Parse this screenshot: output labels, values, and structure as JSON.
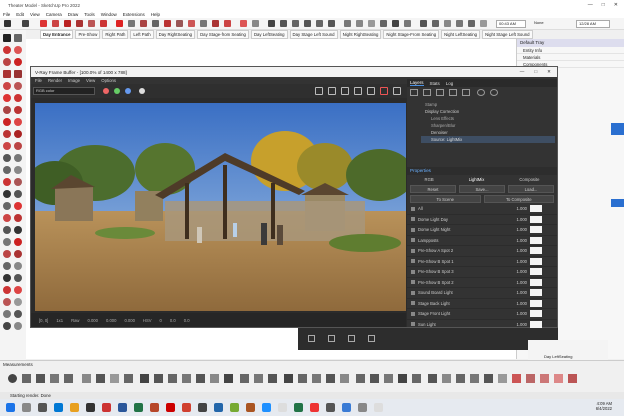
{
  "window": {
    "title": "Theater Model - SketchUp Pro 2022"
  },
  "menubar": {
    "items": [
      "File",
      "Edit",
      "View",
      "Camera",
      "Draw",
      "Tools",
      "Window",
      "Extensions",
      "Help"
    ]
  },
  "toolbar": {
    "time": "00:43 AM",
    "shadow": "None",
    "date": "12/28 AM"
  },
  "scene_tabs": [
    "Day Entrance",
    "Pre-Show",
    "Right Path",
    "Left Path",
    "Day RightSeating",
    "Day Stage-from Seating",
    "Day LeftSeating",
    "Day Stage Left Sound",
    "Night RightSeating",
    "Night Stage-From Seating",
    "Night LeftSeating",
    "Night Stage Left Sound"
  ],
  "tray": {
    "title": "Default Tray",
    "items": [
      "Entity Info",
      "Materials",
      "Components"
    ]
  },
  "vfb": {
    "title": "V-Ray Frame Buffer - [100.0% of 1400 x 788]",
    "menu": [
      "File",
      "Render",
      "Image",
      "View",
      "Options"
    ],
    "channel": "RGB color",
    "status": [
      "[0, 0]",
      "1x1",
      "Raw",
      "0.000",
      "0.000",
      "0.000",
      "HSV",
      "0",
      "0.0",
      "0.0"
    ],
    "panel": {
      "tabs": [
        "Layers",
        "Stats",
        "Log"
      ],
      "layers": [
        "Stamp",
        "Display Correction",
        "Lens Effects",
        "Sharpen/Blur",
        "Denoiser",
        "Source: LightMix"
      ],
      "properties_title": "Properties",
      "mode_options": [
        "RGB",
        "LightMix",
        "Composite"
      ],
      "buttons": [
        "Reset",
        "Save...",
        "Load..."
      ],
      "scene_buttons": [
        "To Scene",
        "To Composite"
      ],
      "lights": [
        {
          "name": "All",
          "value": "1.000"
        },
        {
          "name": "Dome Light Day",
          "value": "1.000"
        },
        {
          "name": "Dome Light Night",
          "value": "1.000"
        },
        {
          "name": "Lampposts",
          "value": "1.000"
        },
        {
          "name": "Pre-Show A Spot 2",
          "value": "1.000"
        },
        {
          "name": "Pre-Show B Spot 1",
          "value": "1.000"
        },
        {
          "name": "Pre-Show B Spot 3",
          "value": "1.000"
        },
        {
          "name": "Pre-Show B Spot 2",
          "value": "1.000"
        },
        {
          "name": "Sound Board Light",
          "value": "1.000"
        },
        {
          "name": "Stage Back Light",
          "value": "1.000"
        },
        {
          "name": "Stage Front Light",
          "value": "1.000"
        },
        {
          "name": "Sun Light",
          "value": "1.000"
        }
      ]
    }
  },
  "scene_info": {
    "label": "Day LeftSeating"
  },
  "measurements": {
    "label": "Measurements"
  },
  "status": {
    "text": "Starting render. Done"
  },
  "taskbar": {
    "time": "4:09 AM",
    "date": "6/4/2022"
  },
  "colors": {
    "accent": "#4a90e2",
    "panel_bg": "#333333",
    "sky_top": "#3a6fc4"
  }
}
